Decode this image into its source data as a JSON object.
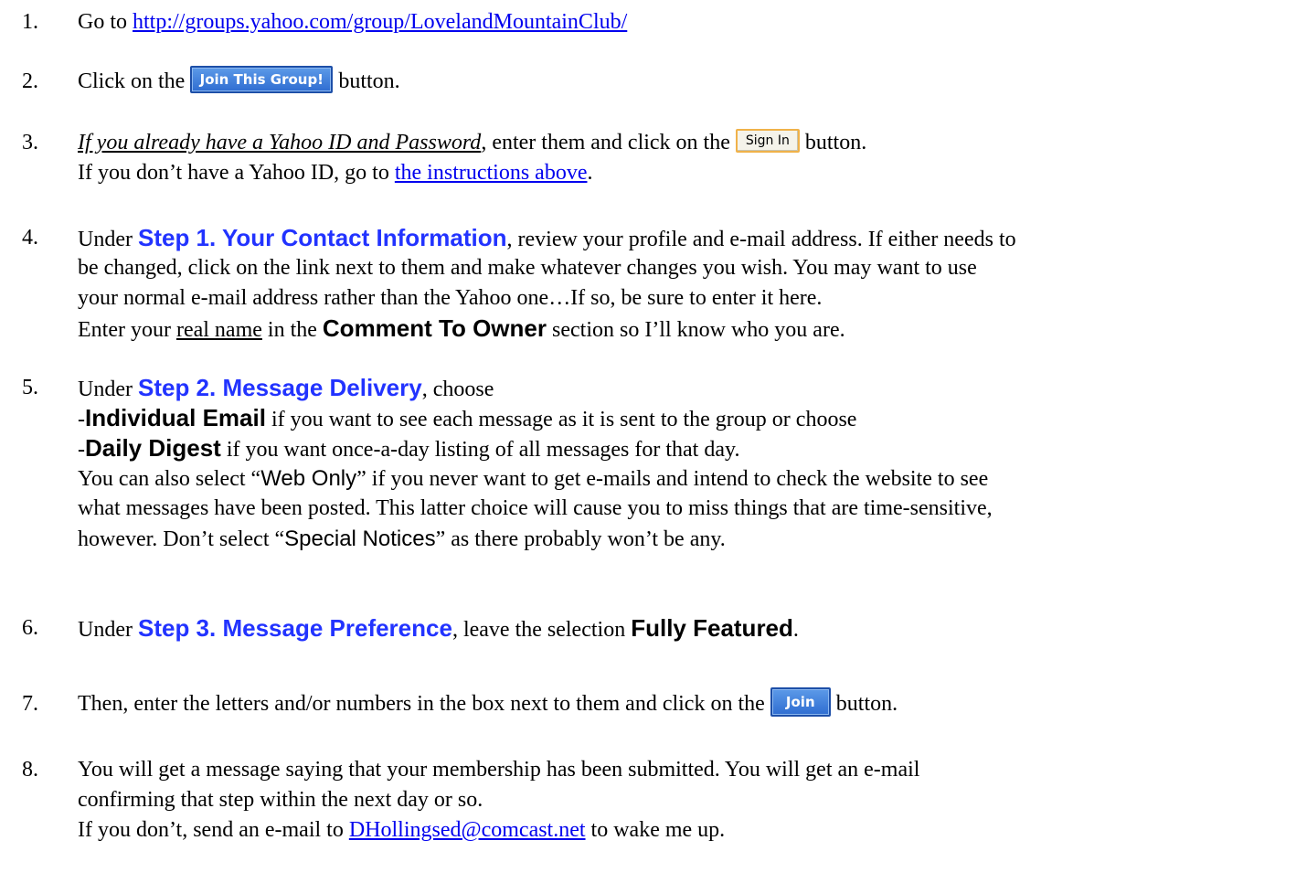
{
  "steps": {
    "s1": {
      "num": "1.",
      "text": "Go to ",
      "url": "http://groups.yahoo.com/group/LovelandMountainClub/"
    },
    "s2": {
      "num": "2.",
      "before": "Click on the",
      "button": "Join This Group!",
      "after": "button."
    },
    "s3": {
      "num": "3.",
      "italic": "If you already have a Yahoo ID and Password",
      "mid": ", enter them and click on the",
      "button": "Sign In",
      "after": "button.",
      "line2_before": "If you don’t have a Yahoo ID, go to ",
      "line2_link": "the instructions above",
      "line2_after": "."
    },
    "s4": {
      "num": "4.",
      "under": "Under ",
      "heading": "Step 1. Your Contact Information",
      "l1_rest": ", review your profile and e-mail address.  If either needs to",
      "l2": "be changed, click on the link next to them and make whatever changes you wish.  You may want to use",
      "l3": "your normal e-mail address rather than the Yahoo one…If so, be sure to enter it here.",
      "l4_a": "Enter your ",
      "l4_u": "real name",
      "l4_b": " in the ",
      "l4_bold": "Comment To Owner",
      "l4_c": " section so I’ll know who you are."
    },
    "s5": {
      "num": "5.",
      "under": "Under ",
      "heading": "Step 2. Message Delivery",
      "l1_rest": ", choose",
      "dash1": "-",
      "opt1": "Individual Email",
      "opt1_rest": " if you want to see each message as it is sent to the group or choose",
      "dash2": "-",
      "opt2": "Daily Digest",
      "opt2_rest": " if you want once-a-day listing of all messages for that day.",
      "l4_a": "You can also select “",
      "l4_sans": "Web Only",
      "l4_b": "” if you never want to get e-mails and intend to check the website to see",
      "l5": "what messages have been posted.  This latter choice will cause you to miss things that are time-sensitive,",
      "l6_a": "however.  Don’t select “",
      "l6_sans": "Special Notices",
      "l6_b": "” as there probably won’t be any."
    },
    "s6": {
      "num": "6.",
      "under": "Under ",
      "heading": "Step 3. Message Preference",
      "mid": ", leave the selection ",
      "bold": "Fully Featured",
      "end": "."
    },
    "s7": {
      "num": "7.",
      "before": "Then, enter the letters and/or numbers in the box next to them and click on the",
      "button": "Join",
      "after": "button."
    },
    "s8": {
      "num": "8.",
      "l1": "You will get a message saying that your membership has been submitted.  You will get an e-mail",
      "l2": "confirming that step within the next day or so.",
      "l3_a": "If you don’t, send an e-mail to ",
      "l3_link": "DHollingsed@comcast.net",
      "l3_b": " to wake me up."
    }
  }
}
